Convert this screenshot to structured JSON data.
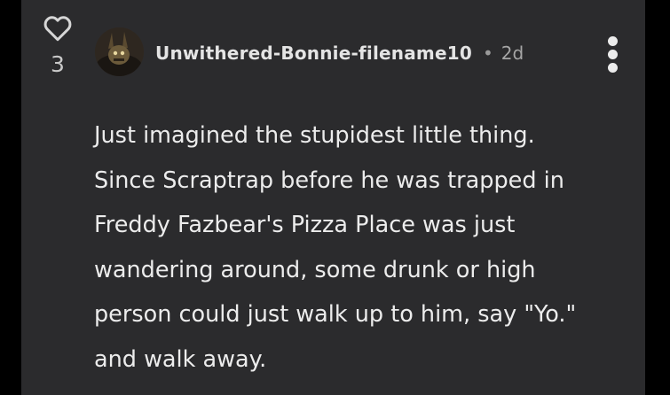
{
  "post": {
    "like_count": "3",
    "username": "Unwithered-Bonnie-filename10",
    "separator": "•",
    "time_ago": "2d",
    "body_lines": [
      "Just imagined the stupidest little thing.",
      "Since Scraptrap before he was trapped in",
      "Freddy Fazbear's Pizza Place was just",
      "wandering around, some drunk or high",
      "person could just walk up to him, say \"Yo.\"",
      "and walk away."
    ]
  },
  "icons": {
    "like": "heart-outline-icon",
    "more": "vertical-ellipsis-icon",
    "avatar": "user-avatar"
  },
  "colors": {
    "card_background": "#2b2b2d",
    "page_background": "#000000",
    "text_primary": "#ececec",
    "text_secondary": "#a6a6a6"
  }
}
